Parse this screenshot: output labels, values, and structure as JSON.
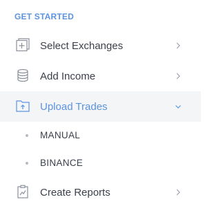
{
  "sidebar": {
    "section_title": "GET STARTED",
    "accent_color": "#5b93e0",
    "items": [
      {
        "label": "Select Exchanges",
        "icon": "window-plus-icon",
        "expanded": false,
        "active": false
      },
      {
        "label": "Add Income",
        "icon": "coin-stack-icon",
        "expanded": false,
        "active": false
      },
      {
        "label": "Upload Trades",
        "icon": "folder-upload-icon",
        "expanded": true,
        "active": true,
        "subitems": [
          {
            "label": "MANUAL"
          },
          {
            "label": "BINANCE"
          }
        ]
      },
      {
        "label": "Create Reports",
        "icon": "clipboard-chart-icon",
        "expanded": false,
        "active": false
      }
    ]
  }
}
